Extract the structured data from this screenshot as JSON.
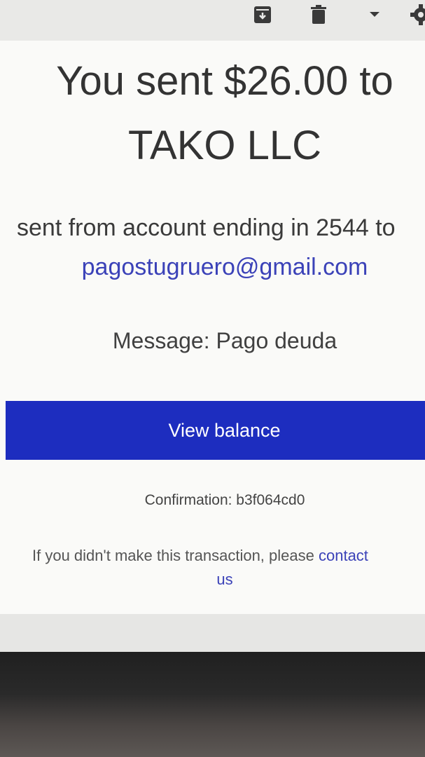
{
  "toolbar": {
    "icons": [
      "archive-icon",
      "delete-icon",
      "dropdown-icon",
      "settings-icon"
    ]
  },
  "headline": {
    "line1": "You sent $26.00 to",
    "line2": "TAKO LLC"
  },
  "details": {
    "sent_from": "sent from account ending in 2544 to",
    "email": "pagostugruero@gmail.com",
    "message": "Message: Pago deuda"
  },
  "actions": {
    "view_balance_label": "View balance"
  },
  "confirmation": "Confirmation: b3f064cd0",
  "disclaimer": {
    "text": "If you didn't make this transaction, please ",
    "link_part1": "contact",
    "link_part2": "us"
  },
  "colors": {
    "accent": "#1d2dbf",
    "link": "#3b42b8",
    "text": "#333333"
  }
}
